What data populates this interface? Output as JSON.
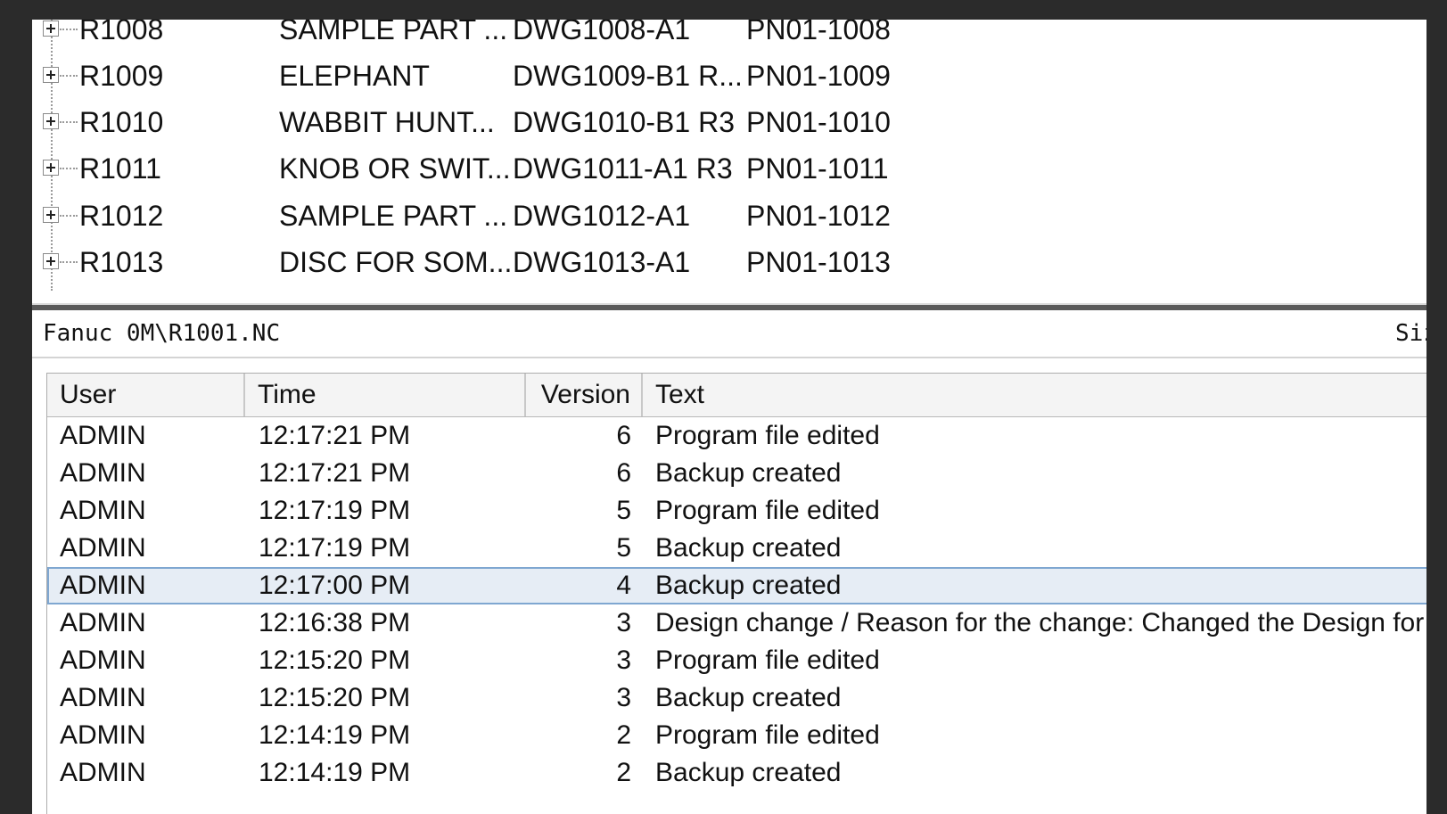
{
  "tree": {
    "rows": [
      {
        "id": "R1008",
        "name": "SAMPLE PART ...",
        "drawing": "DWG1008-A1",
        "part_number": "PN01-1008"
      },
      {
        "id": "R1009",
        "name": "ELEPHANT",
        "drawing": "DWG1009-B1 R...",
        "part_number": "PN01-1009"
      },
      {
        "id": "R1010",
        "name": "WABBIT HUNT...",
        "drawing": "DWG1010-B1 R3",
        "part_number": "PN01-1010"
      },
      {
        "id": "R1011",
        "name": "KNOB OR SWIT...",
        "drawing": "DWG1011-A1 R3",
        "part_number": "PN01-1011"
      },
      {
        "id": "R1012",
        "name": "SAMPLE PART ...",
        "drawing": "DWG1012-A1",
        "part_number": "PN01-1012"
      },
      {
        "id": "R1013",
        "name": "DISC FOR SOM...",
        "drawing": "DWG1013-A1",
        "part_number": "PN01-1013"
      }
    ]
  },
  "path_bar": {
    "path": "Fanuc 0M\\R1001.NC",
    "size_label": "Siz"
  },
  "history": {
    "columns": {
      "user": "User",
      "time": "Time",
      "version": "Version",
      "text": "Text"
    },
    "rows": [
      {
        "user": "ADMIN",
        "time": "12:17:21 PM",
        "version": "6",
        "text": "Program file edited",
        "selected": false
      },
      {
        "user": "ADMIN",
        "time": "12:17:21 PM",
        "version": "6",
        "text": "Backup created",
        "selected": false
      },
      {
        "user": "ADMIN",
        "time": "12:17:19 PM",
        "version": "5",
        "text": "Program file edited",
        "selected": false
      },
      {
        "user": "ADMIN",
        "time": "12:17:19 PM",
        "version": "5",
        "text": "Backup created",
        "selected": false
      },
      {
        "user": "ADMIN",
        "time": "12:17:00 PM",
        "version": "4",
        "text": "Backup created",
        "selected": true
      },
      {
        "user": "ADMIN",
        "time": "12:16:38 PM",
        "version": "3",
        "text": "Design change / Reason for the change: Changed the Design for",
        "selected": false
      },
      {
        "user": "ADMIN",
        "time": "12:15:20 PM",
        "version": "3",
        "text": "Program file edited",
        "selected": false
      },
      {
        "user": "ADMIN",
        "time": "12:15:20 PM",
        "version": "3",
        "text": "Backup created",
        "selected": false
      },
      {
        "user": "ADMIN",
        "time": "12:14:19 PM",
        "version": "2",
        "text": "Program file edited",
        "selected": false
      },
      {
        "user": "ADMIN",
        "time": "12:14:19 PM",
        "version": "2",
        "text": "Backup created",
        "selected": false
      }
    ]
  }
}
